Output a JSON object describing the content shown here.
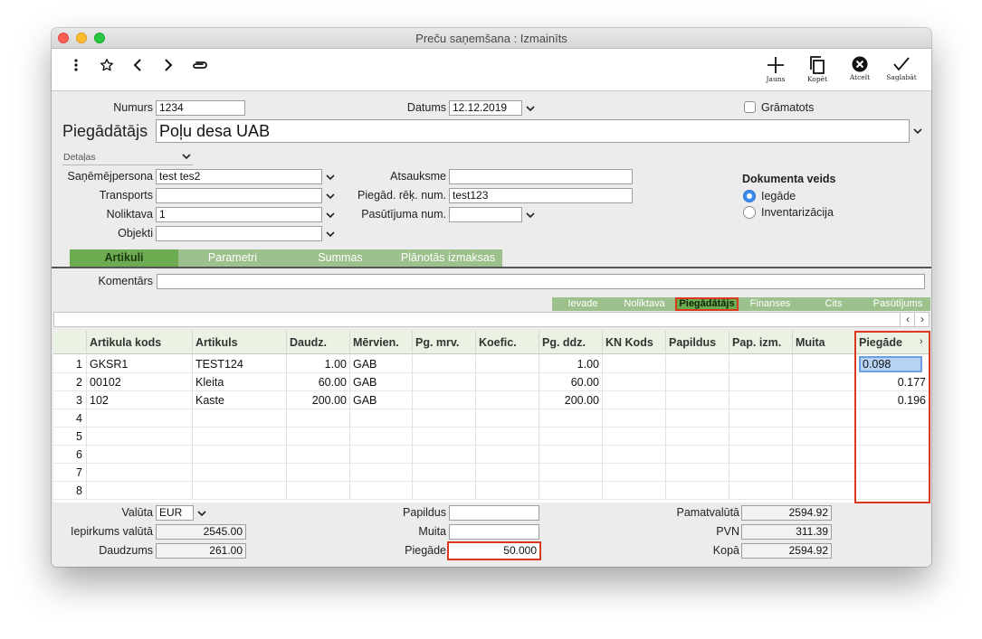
{
  "window": {
    "title": "Preču saņemšana : Izmainīts",
    "controls": {
      "close": "#fc5f57",
      "minimize": "#fdbc2e",
      "zoom": "#29c840"
    }
  },
  "toolbar": {
    "left_icons": [
      "more-vertical-icon",
      "star-icon",
      "chevron-left-icon",
      "chevron-right-icon",
      "paperclip-icon"
    ],
    "new_label": "Jauns",
    "copy_label": "Kopēt",
    "cancel_label": "Atcelt",
    "save_label": "Saglabāt"
  },
  "header": {
    "number_label": "Numurs",
    "number_value": "1234",
    "date_label": "Datums",
    "date_value": "12.12.2019",
    "posted_label": "Grāmatots",
    "supplier_label": "Piegādātājs",
    "supplier_value": "Poļu desa UAB"
  },
  "details": {
    "section_label": "Detaļas",
    "receiver_label": "Saņēmējpersona",
    "receiver_value": "test tes2",
    "transport_label": "Transports",
    "transport_value": "",
    "warehouse_label": "Noliktava",
    "warehouse_value": "1",
    "objects_label": "Objekti",
    "objects_value": "",
    "reference_label": "Atsauksme",
    "reference_value": "",
    "invoice_label": "Piegād. rēķ. num.",
    "invoice_value": "test123",
    "order_label": "Pasūtījuma num.",
    "order_value": "",
    "doc_type_label": "Dokumenta veids",
    "doc_type_options": [
      "Iegāde",
      "Inventarizācija"
    ],
    "doc_type_selected": "Iegāde"
  },
  "tabs": [
    "Artikuli",
    "Parametri",
    "Summas",
    "Plānotās izmaksas"
  ],
  "active_tab": "Artikuli",
  "comment_label": "Komentārs",
  "comment_value": "",
  "subtabs": [
    "Ievade",
    "Noliktava",
    "Piegādātājs",
    "Finanses",
    "Cits",
    "Pasūtījums"
  ],
  "active_subtab": "Piegādātājs",
  "grid": {
    "columns": [
      "Artikula kods",
      "Artikuls",
      "Daudz.",
      "Mērvien.",
      "Pg. mrv.",
      "Koefic.",
      "Pg. ddz.",
      "KN Kods",
      "Papildus",
      "Pap. izm.",
      "Muita",
      "Piegāde"
    ],
    "rows": [
      {
        "n": "1",
        "code": "GKSR1",
        "item": "TEST124",
        "qty": "1.00",
        "unit": "GAB",
        "pg_ddz": "1.00",
        "delivery": "0.098"
      },
      {
        "n": "2",
        "code": "00102",
        "item": "Kleita",
        "qty": "60.00",
        "unit": "GAB",
        "pg_ddz": "60.00",
        "delivery": "0.177"
      },
      {
        "n": "3",
        "code": "102",
        "item": "Kaste",
        "qty": "200.00",
        "unit": "GAB",
        "pg_ddz": "200.00",
        "delivery": "0.196"
      },
      {
        "n": "4"
      },
      {
        "n": "5"
      },
      {
        "n": "6"
      },
      {
        "n": "7"
      },
      {
        "n": "8"
      }
    ]
  },
  "totals": {
    "currency_label": "Valūta",
    "currency_value": "EUR",
    "purchase_label": "Iepirkums valūtā",
    "purchase_value": "2545.00",
    "quantity_label": "Daudzums",
    "quantity_value": "261.00",
    "extra_label": "Papildus",
    "extra_value": "",
    "customs_label": "Muita",
    "customs_value": "",
    "delivery_label": "Piegāde",
    "delivery_value": "50.000",
    "base_label": "Pamatvalūtā",
    "base_value": "2594.92",
    "vat_label": "PVN",
    "vat_value": "311.39",
    "total_label": "Kopā",
    "total_value": "2594.92"
  },
  "colors": {
    "tab_green": "#9cc18d",
    "tab_active": "#6cab50",
    "highlight_red": "#d9391f",
    "header_green": "#eaf3e3"
  }
}
